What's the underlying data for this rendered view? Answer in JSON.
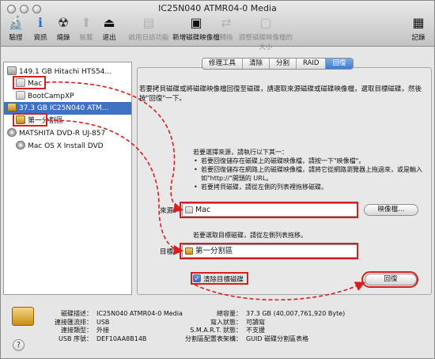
{
  "window": {
    "title": "IC25N040 ATMR04-0 Media"
  },
  "toolbar": [
    {
      "label": "驗證",
      "icon": "microscope-icon",
      "glyph": "🔬",
      "enabled": true
    },
    {
      "label": "資訊",
      "icon": "info-icon",
      "glyph": "ℹ",
      "enabled": true
    },
    {
      "label": "燒錄",
      "icon": "burn-icon",
      "glyph": "☢",
      "enabled": true
    },
    {
      "label": "裝載",
      "icon": "mount-icon",
      "glyph": "⬆",
      "enabled": false
    },
    {
      "label": "退出",
      "icon": "eject-icon",
      "glyph": "⏏",
      "enabled": true
    },
    {
      "label": "啟用日誌功能",
      "icon": "journal-icon",
      "glyph": "▤",
      "enabled": false
    },
    {
      "label": "新增磁碟映像檔",
      "icon": "new-image-icon",
      "glyph": "▣",
      "enabled": true
    },
    {
      "label": "轉換",
      "icon": "convert-icon",
      "glyph": "⇄",
      "enabled": false
    },
    {
      "label": "調整磁碟映像檔的大小",
      "icon": "resize-image-icon",
      "glyph": "▢",
      "enabled": false
    },
    {
      "label": "記錄",
      "icon": "log-icon",
      "glyph": "▦",
      "enabled": true
    }
  ],
  "sidebar": {
    "items": [
      {
        "label": "149.1 GB Hitachi HTS54...",
        "kind": "disk",
        "selected": false
      },
      {
        "label": "Mac",
        "kind": "volume",
        "selected": false
      },
      {
        "label": "BootCampXP",
        "kind": "volume",
        "selected": false
      },
      {
        "label": "37.3 GB IC25N040 ATM...",
        "kind": "usb",
        "selected": true
      },
      {
        "label": "第一分割區",
        "kind": "usb-volume",
        "selected": false
      },
      {
        "label": "MATSHITA DVD-R UJ-857",
        "kind": "optical",
        "selected": false
      },
      {
        "label": "Mac OS X Install DVD",
        "kind": "optical-volume",
        "selected": false
      }
    ]
  },
  "tabs": [
    {
      "label": "修理工具",
      "active": false
    },
    {
      "label": "清除",
      "active": false
    },
    {
      "label": "分割",
      "active": false
    },
    {
      "label": "RAID",
      "active": false
    },
    {
      "label": "回復",
      "active": true
    }
  ],
  "restore": {
    "intro": "若要拷貝磁碟或將磁碟映像檔回復至磁碟，請選取來源磁碟或磁碟映像檔，選取目標磁碟，然後按\"回復\"一下。",
    "instructions_title": "若要選擇來源，請執行以下其一：",
    "instructions": [
      "若要回復儲存在磁碟上的磁碟映像檔，請按一下\"映像檔\"。",
      "若要回復儲存在網路上的磁碟映像檔，請將它從網路瀏覽器上拖過來，或是輸入如\"http://\"開頭的 URL。",
      "若要拷貝磁碟，請從左側的列表裡拖移磁碟。"
    ],
    "source_label": "來源：",
    "source_value": "Mac",
    "image_button": "映像檔…",
    "target_hint": "若要選取目標磁碟，請從左側列表拖移。",
    "target_label": "目標：",
    "target_value": "第一分割區",
    "erase_checkbox": "清除目標磁碟",
    "erase_checked": true,
    "restore_button": "回復"
  },
  "info": {
    "left": [
      {
        "k": "磁碟描述：",
        "v": "IC25N040 ATMR04-0 Media"
      },
      {
        "k": "連接匯流排：",
        "v": "USB"
      },
      {
        "k": "連接類型：",
        "v": "外接"
      },
      {
        "k": "USB 序號：",
        "v": "DEF10AA8B14B"
      }
    ],
    "right": [
      {
        "k": "總容量：",
        "v": "37.3 GB (40,007,761,920 Byte)"
      },
      {
        "k": "寫入狀態：",
        "v": "可讀寫"
      },
      {
        "k": "S.M.A.R.T. 狀態：",
        "v": "不支援"
      },
      {
        "k": "分割區配置表架構：",
        "v": "GUID 磁碟分割區表格"
      }
    ]
  },
  "help": {
    "label": "?"
  },
  "colors": {
    "selection": "#3d72c4",
    "annotation": "#d81f1f"
  }
}
